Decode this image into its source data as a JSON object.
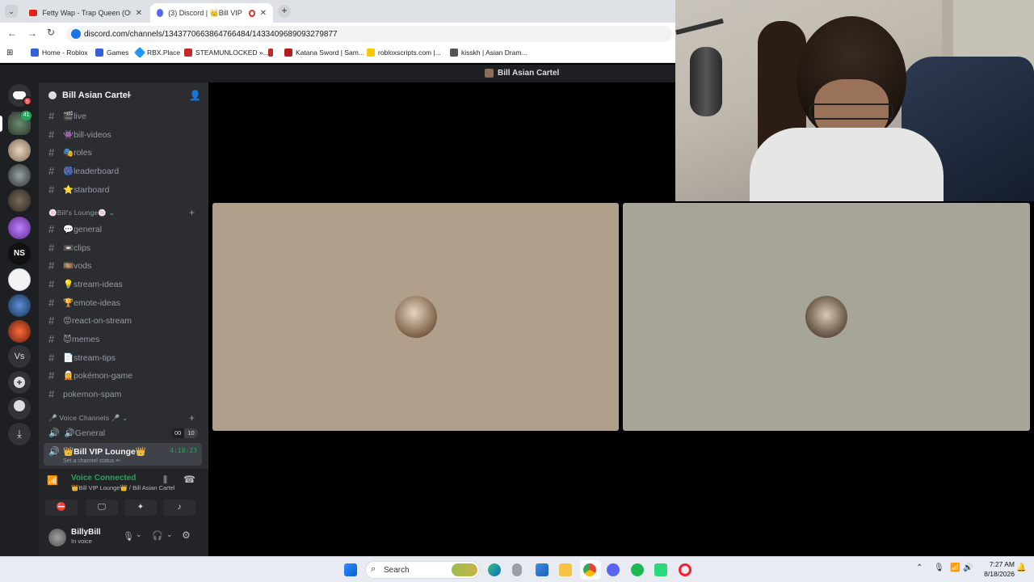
{
  "browser": {
    "tabs": [
      {
        "label": "Fetty Wap - Trap Queen (Officia",
        "active": false
      },
      {
        "label": "(3) Discord | 👑Bill VIP Loun",
        "active": true
      }
    ],
    "url": "discord.com/channels/1343770663864766484/1433409689093279877",
    "bookmarks": [
      "Home - Roblox",
      "Games",
      "RBX.Place",
      "STEAMUNLOCKED »...",
      "Katana Sword | Sam...",
      "robloxscripts.com |...",
      "kisskh | Asian Dram..."
    ]
  },
  "discord": {
    "window_title": "Bill Asian Cartel",
    "server_name": "Bill Asian Cartel",
    "home_badge": "5",
    "guild_badge": "41",
    "guild_text_ns": "NS",
    "guild_text_vs": "Vs",
    "channels_top": [
      {
        "emoji": "🎬",
        "name": "live"
      },
      {
        "emoji": "👾",
        "name": "bill-videos"
      },
      {
        "emoji": "🎭",
        "name": "roles"
      },
      {
        "emoji": "🎆",
        "name": "leaderboard"
      },
      {
        "emoji": "⭐",
        "name": "starboard"
      }
    ],
    "lounge_category": "🍥Bill's Lounge🍥",
    "channels_lounge": [
      {
        "emoji": "💬",
        "name": "general"
      },
      {
        "emoji": "📼",
        "name": "clips"
      },
      {
        "emoji": "🎞️",
        "name": "vods"
      },
      {
        "emoji": "💡",
        "name": "stream-ideas"
      },
      {
        "emoji": "🏆",
        "name": "emote-ideas"
      },
      {
        "emoji": "😡",
        "name": "react-on-stream"
      },
      {
        "emoji": "😈",
        "name": "memes"
      },
      {
        "emoji": "📄",
        "name": "stream-tips"
      },
      {
        "emoji": "🧝",
        "name": "pokémon-game"
      },
      {
        "emoji": "",
        "name": "pokemon-spam"
      }
    ],
    "voice_category": "🎤 Voice Channels 🎤",
    "voice_general": {
      "name": "🔊General",
      "count_a": "00",
      "count_b": "10"
    },
    "voice_vip": {
      "name": "👑Bill VIP Lounge👑",
      "timer": "4:18:23",
      "status": "Set a channel status ✏"
    },
    "voice_panel": {
      "title": "Voice Connected",
      "subtitle": "👑Bill VIP Lounge👑 / Bill Asian Cartel"
    },
    "user": {
      "name": "BillyBill",
      "status": "In voice"
    },
    "colors": {
      "tile_left": "#b09f8b",
      "tile_right": "#a7a498",
      "voice_green": "#23a55a",
      "accent": "#5865f2"
    }
  },
  "taskbar": {
    "search_placeholder": "Search",
    "time": "7:27 AM",
    "date": "8/18/2026"
  }
}
